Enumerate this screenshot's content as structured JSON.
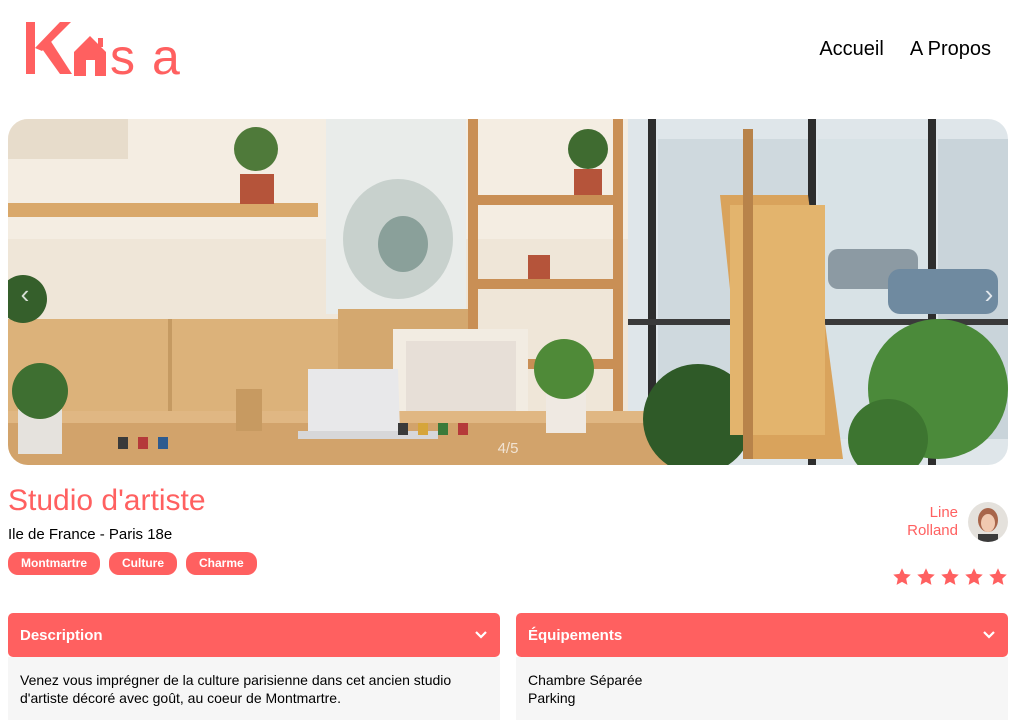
{
  "brand": {
    "logo_text": "Kasa",
    "accent": "#FF6060"
  },
  "nav": {
    "items": [
      "Accueil",
      "A Propos"
    ]
  },
  "gallery": {
    "counter": "4/5",
    "prev_icon": "chevron-left-icon",
    "next_icon": "chevron-right-icon"
  },
  "listing": {
    "title": "Studio d'artiste",
    "location": "Ile de France - Paris 18e",
    "tags": [
      "Montmartre",
      "Culture",
      "Charme"
    ],
    "host": {
      "first_name": "Line",
      "last_name": "Rolland"
    },
    "rating": 5,
    "rating_max": 5
  },
  "description": {
    "header": "Description",
    "text": "Venez vous imprégner de la culture parisienne dans cet ancien studio d'artiste décoré avec goût, au coeur de Montmartre."
  },
  "equipments": {
    "header": "Équipements",
    "items": [
      "Chambre Séparée",
      "Parking"
    ]
  }
}
